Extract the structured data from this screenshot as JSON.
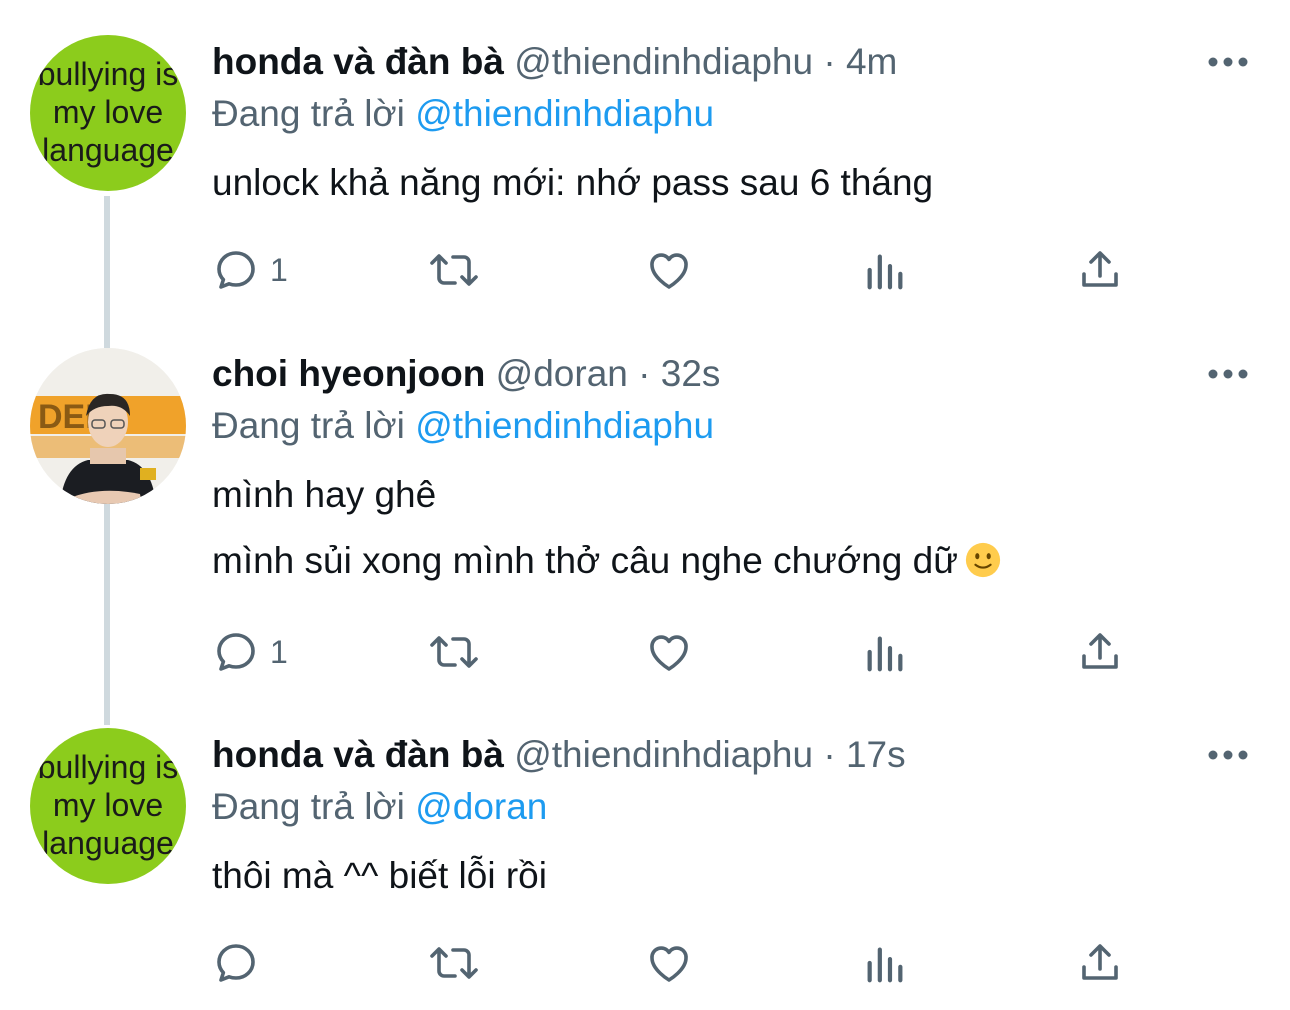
{
  "tweets": [
    {
      "name": "honda và đàn bà",
      "handle": "@thiendinhdiaphu",
      "separator": "·",
      "time": "4m",
      "replying_prefix": "Đang trả lời",
      "replying_to": "@thiendinhdiaphu",
      "lines": [
        "unlock khả năng mới: nhớ pass sau 6 tháng"
      ],
      "reply_count": "1",
      "avatar": {
        "type": "text",
        "lines": [
          "bullying is",
          "my love",
          "language"
        ],
        "bg": "#8ccc1c"
      }
    },
    {
      "name": "choi hyeonjoon",
      "handle": "@doran",
      "separator": "·",
      "time": "32s",
      "replying_prefix": "Đang trả lời",
      "replying_to": "@thiendinhdiaphu",
      "lines": [
        "mình hay ghê",
        "mình sủi xong mình thở câu nghe chướng dữ"
      ],
      "emoji": "slightly-smiling-face",
      "reply_count": "1",
      "avatar": {
        "type": "photo"
      }
    },
    {
      "name": "honda và đàn bà",
      "handle": "@thiendinhdiaphu",
      "separator": "·",
      "time": "17s",
      "replying_prefix": "Đang trả lời",
      "replying_to": "@doran",
      "lines": [
        "thôi mà ^^ biết lỗi rồi"
      ],
      "reply_count": "",
      "avatar": {
        "type": "text",
        "lines": [
          "bullying is",
          "my love",
          "language"
        ],
        "bg": "#8ccc1c"
      }
    }
  ],
  "colors": {
    "text": "#0f1419",
    "secondary": "#536471",
    "mention": "#1d9bf0",
    "thread_line": "#cfd9de"
  },
  "icons": [
    "reply-icon",
    "retweet-icon",
    "like-icon",
    "analytics-icon",
    "share-icon",
    "more-icon"
  ]
}
